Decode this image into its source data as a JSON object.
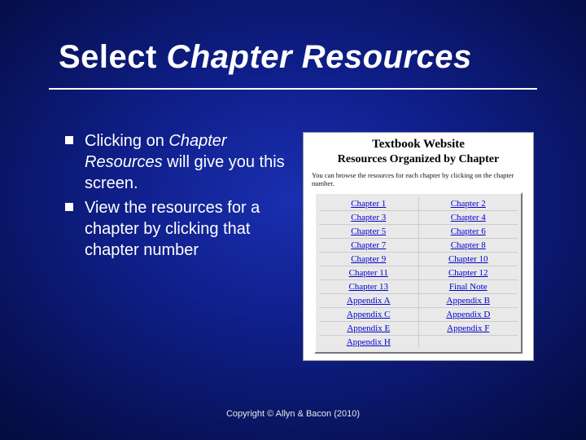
{
  "title": {
    "prefix": "Select ",
    "italic": "Chapter Resources"
  },
  "bullets": [
    {
      "pre": "Clicking on ",
      "italic": "Chapter Resources",
      "post": " will give you this screen."
    },
    {
      "pre": "View the resources for a chapter by clicking that chapter number",
      "italic": "",
      "post": ""
    }
  ],
  "screenshot": {
    "title": "Textbook Website",
    "subtitle": "Resources Organized by Chapter",
    "blurb": "You can browse the resources for each chapter by clicking on the chapter number.",
    "grid": [
      [
        "Chapter 1",
        "Chapter 2"
      ],
      [
        "Chapter 3",
        "Chapter 4"
      ],
      [
        "Chapter 5",
        "Chapter 6"
      ],
      [
        "Chapter 7",
        "Chapter 8"
      ],
      [
        "Chapter 9",
        "Chapter 10"
      ],
      [
        "Chapter 11",
        "Chapter 12"
      ],
      [
        "Chapter 13",
        "Final Note"
      ],
      [
        "Appendix A",
        "Appendix B"
      ],
      [
        "Appendix C",
        "Appendix D"
      ],
      [
        "Appendix E",
        "Appendix F"
      ],
      [
        "Appendix H",
        ""
      ]
    ]
  },
  "footer": "Copyright © Allyn & Bacon (2010)"
}
